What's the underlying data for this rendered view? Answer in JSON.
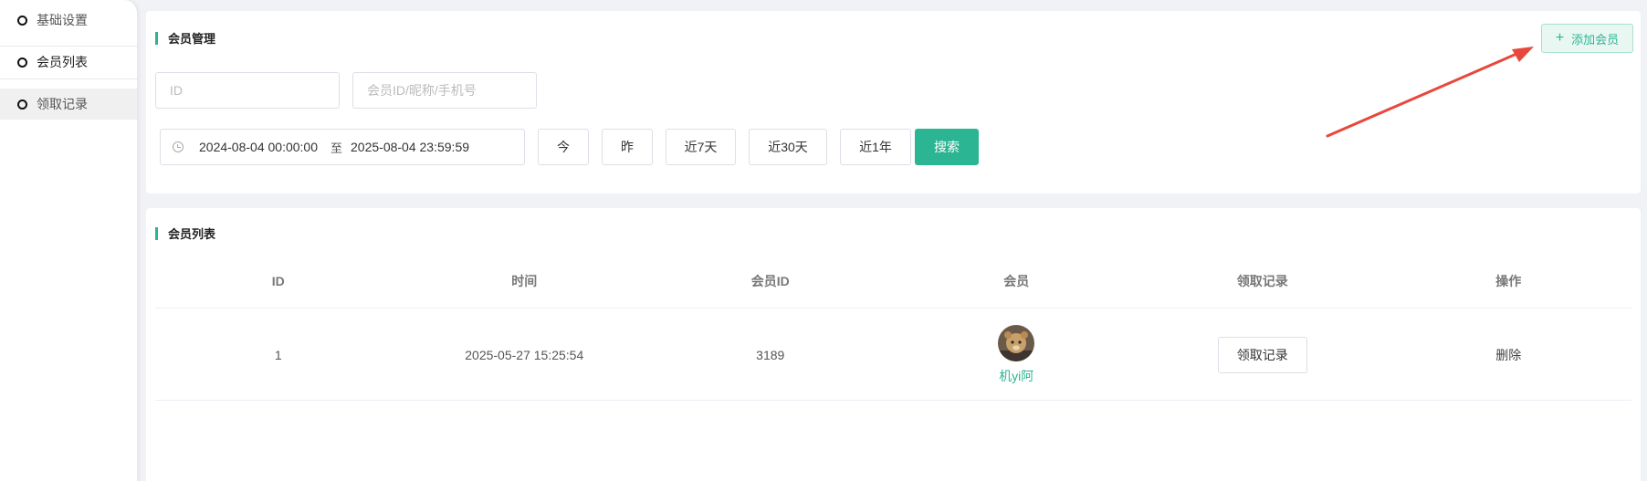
{
  "sidebar": {
    "items": [
      {
        "label": "基础设置"
      },
      {
        "label": "会员列表"
      },
      {
        "label": "领取记录"
      }
    ]
  },
  "filter_panel": {
    "title": "会员管理",
    "add_button": "添加会员",
    "id_placeholder": "ID",
    "member_placeholder": "会员ID/昵称/手机号",
    "date_start": "2024-08-04 00:00:00",
    "date_separator": "至",
    "date_end": "2025-08-04 23:59:59",
    "quick": {
      "today": "今",
      "yesterday": "昨",
      "last7": "近7天",
      "last30": "近30天",
      "last1y": "近1年"
    },
    "search_button": "搜索"
  },
  "list_panel": {
    "title": "会员列表",
    "columns": [
      "ID",
      "时间",
      "会员ID",
      "会员",
      "领取记录",
      "操作"
    ],
    "rows": [
      {
        "id": "1",
        "time": "2025-05-27 15:25:54",
        "member_id": "3189",
        "nickname": "机yi阿",
        "record_button": "领取记录",
        "action": "删除"
      }
    ]
  },
  "colors": {
    "accent": "#2bb592",
    "annotation_arrow": "#e8483b"
  }
}
